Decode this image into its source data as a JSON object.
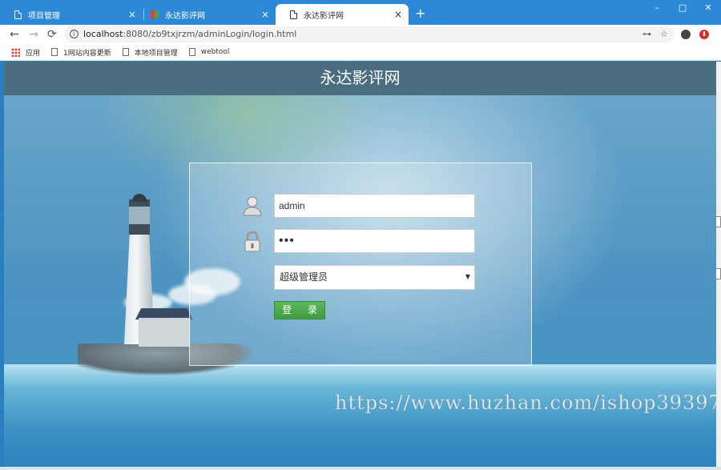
{
  "browser": {
    "tabs": [
      {
        "title": "项目管理",
        "active": false
      },
      {
        "title": "永达影评网",
        "active": false
      },
      {
        "title": "永达影评网",
        "active": true
      }
    ],
    "close_glyph": "×",
    "new_tab_glyph": "+",
    "window": {
      "minimize": "–",
      "maximize": "□",
      "close": "✕"
    },
    "nav": {
      "back": "←",
      "forward": "→",
      "reload": "⟳"
    },
    "url": {
      "host": "localhost",
      "path": ":8080/zb9txjrzm/adminLogin/login.html"
    },
    "omnibox_icons": {
      "key": "⊶",
      "star": "☆"
    },
    "bookmarks": [
      {
        "label": "应用",
        "icon": "apps-grid-icon"
      },
      {
        "label": "1网站内容更新",
        "icon": "page-icon"
      },
      {
        "label": "本地项目管理",
        "icon": "page-icon"
      },
      {
        "label": "webtool",
        "icon": "page-icon"
      }
    ]
  },
  "page": {
    "header_title": "永达影评网",
    "login": {
      "username_value": "admin",
      "password_value": "•••",
      "role_selected": "超级管理员",
      "submit_label": "登 录"
    },
    "watermark": "https://www.huzhan.com/ishop39397"
  },
  "colors": {
    "tab_strip": "#2d89d8",
    "header_bar": "#4a6e80",
    "login_button": "#4cae4c"
  }
}
